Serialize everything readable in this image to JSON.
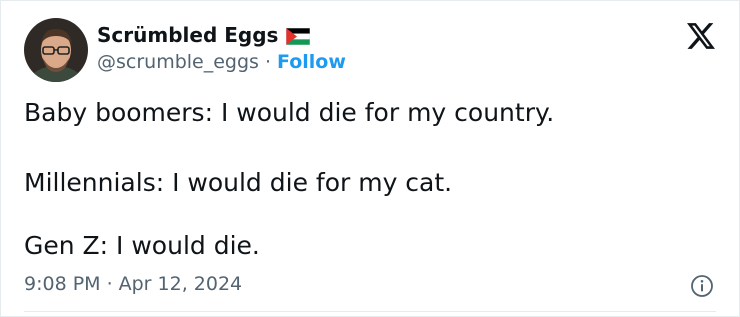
{
  "author": {
    "display_name": "Scrümbled Eggs",
    "handle": "@scrumble_eggs",
    "separator": "·",
    "follow_label": "Follow",
    "flag_icon": "palestine-flag-icon"
  },
  "tweet": {
    "lines": [
      "Baby boomers: I would die for my country.",
      "Millennials: I would die for my cat.",
      "Gen Z: I would die."
    ]
  },
  "meta": {
    "time": "9:08 PM",
    "separator": "·",
    "date": "Apr 12, 2024"
  },
  "icons": {
    "brand": "x-logo-icon",
    "info": "info-icon"
  },
  "colors": {
    "text": "#0f1419",
    "secondary": "#536471",
    "accent": "#1d9bf0",
    "border": "#e6ebee"
  }
}
